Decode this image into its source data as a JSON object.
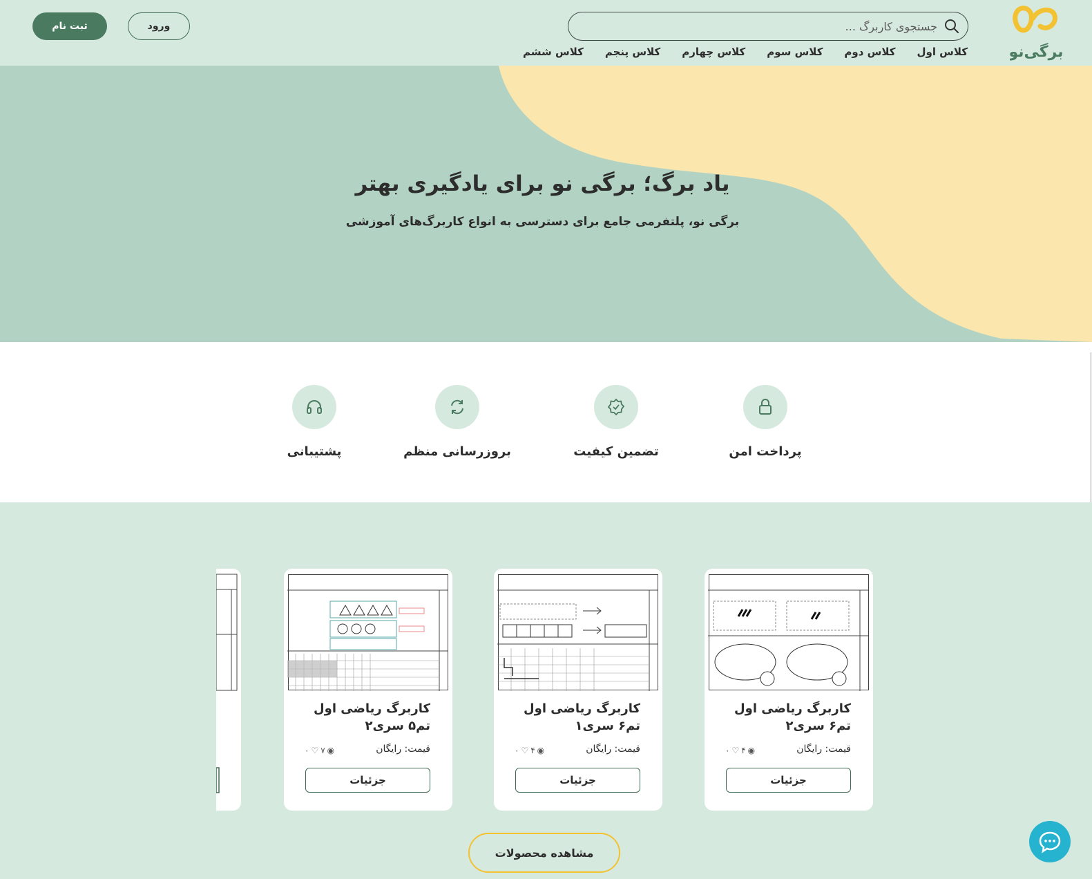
{
  "brand": {
    "logo_text": "برگی‌نو",
    "colors": {
      "green": "#4a7a5f",
      "yellow": "#f2c233",
      "mint": "#d6e9df",
      "hero": "#b2d3c3",
      "cream": "#fbe6ae"
    }
  },
  "header": {
    "search_placeholder": "جستجوی کاربرگ ...",
    "nav": [
      "کلاس اول",
      "کلاس دوم",
      "کلاس سوم",
      "کلاس چهارم",
      "کلاس پنجم",
      "کلاس ششم"
    ],
    "login_label": "ورود",
    "signup_label": "ثبت نام"
  },
  "hero": {
    "title": "یاد برگ؛ برگی نو برای یادگیری بهتر",
    "subtitle": "برگی نو، پلتفرمی جامع برای دسترسی به انواع کاربرگ‌های آموزشی"
  },
  "features": [
    {
      "label": "پرداخت امن",
      "icon": "lock-icon"
    },
    {
      "label": "تضمین کیفیت",
      "icon": "badge-check-icon"
    },
    {
      "label": "بروزرسانی منظم",
      "icon": "refresh-icon"
    },
    {
      "label": "پشتیبانی",
      "icon": "headset-icon"
    }
  ],
  "products": [
    {
      "title": "کاربرگ ریاضی اول تم۶ سری۲",
      "price": "قیمت: رایگان",
      "views": "۴",
      "likes": "۰",
      "details_label": "جزئیات"
    },
    {
      "title": "کاربرگ ریاضی اول تم۶ سری۱",
      "price": "قیمت: رایگان",
      "views": "۴",
      "likes": "۰",
      "details_label": "جزئیات"
    },
    {
      "title": "کاربرگ ریاضی اول تم۵ سری۲",
      "price": "قیمت: رایگان",
      "views": "۷",
      "likes": "۰",
      "details_label": "جزئیات"
    }
  ],
  "view_all_label": "مشاهده محصولات",
  "chat_icon": "chat-icon"
}
